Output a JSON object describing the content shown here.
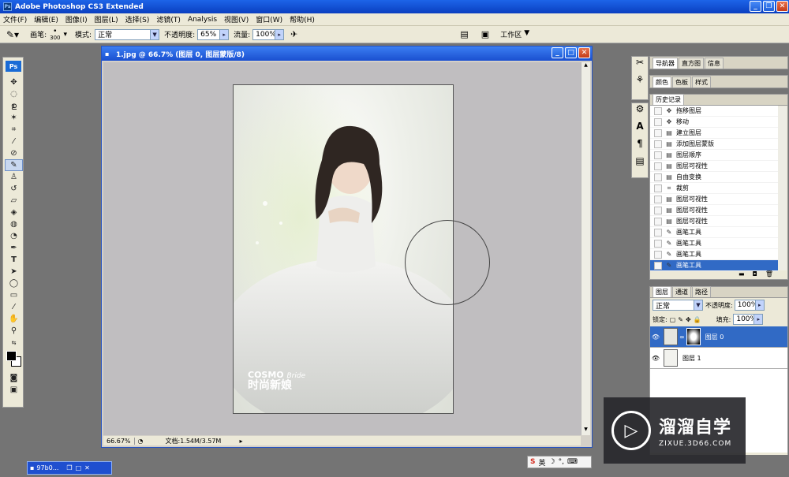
{
  "app": {
    "title": "Adobe Photoshop CS3 Extended",
    "logo": "Ps"
  },
  "menu": [
    "文件(F)",
    "编辑(E)",
    "图像(I)",
    "图层(L)",
    "选择(S)",
    "滤镜(T)",
    "Analysis",
    "视图(V)",
    "窗口(W)",
    "帮助(H)"
  ],
  "options": {
    "brush_label": "画笔:",
    "brush_size": "300",
    "mode_label": "模式:",
    "mode_value": "正常",
    "opacity_label": "不透明度:",
    "opacity_value": "65%",
    "flow_label": "流量:",
    "flow_value": "100%",
    "workspace_label": "工作区"
  },
  "document": {
    "title": "1.jpg @ 66.7% (图层 0, 图层蒙版/8)",
    "zoom": "66.67%",
    "doc_size": "文档:1.54M/3.57M",
    "photo_text_1": "COSMO",
    "photo_text_2": "Bride",
    "photo_text_3": "时尚新娘"
  },
  "navigator_tabs": [
    "导航器",
    "直方图",
    "信息"
  ],
  "color_tabs": [
    "颜色",
    "色板",
    "样式"
  ],
  "history": {
    "tab": "历史记录",
    "items": [
      {
        "label": "拖移图层",
        "icon": "move-icon"
      },
      {
        "label": "移动",
        "icon": "move-icon"
      },
      {
        "label": "建立图层",
        "icon": "layer-icon"
      },
      {
        "label": "添加图层蒙版",
        "icon": "layer-icon"
      },
      {
        "label": "图层顺序",
        "icon": "layer-icon"
      },
      {
        "label": "图层可视性",
        "icon": "layer-icon"
      },
      {
        "label": "自由变换",
        "icon": "layer-icon"
      },
      {
        "label": "裁剪",
        "icon": "crop-icon"
      },
      {
        "label": "图层可视性",
        "icon": "layer-icon"
      },
      {
        "label": "图层可视性",
        "icon": "layer-icon"
      },
      {
        "label": "图层可视性",
        "icon": "layer-icon"
      },
      {
        "label": "画笔工具",
        "icon": "brush-icon"
      },
      {
        "label": "画笔工具",
        "icon": "brush-icon"
      },
      {
        "label": "画笔工具",
        "icon": "brush-icon"
      },
      {
        "label": "画笔工具",
        "icon": "brush-icon",
        "selected": true
      }
    ]
  },
  "layers": {
    "tabs": [
      "图层",
      "通道",
      "路径"
    ],
    "blend_mode": "正常",
    "opacity_label": "不透明度:",
    "opacity_value": "100%",
    "lock_label": "锁定:",
    "fill_label": "填充:",
    "fill_value": "100%",
    "items": [
      {
        "name": "图层 0",
        "selected": true
      },
      {
        "name": "图层 1"
      }
    ]
  },
  "taskbar": {
    "minimized_doc": "97b0..."
  },
  "ime": {
    "mode": "英"
  },
  "watermark": {
    "title": "溜溜自学",
    "url": "ZIXUE.3D66.COM"
  },
  "colors": {
    "accent": "#316ac5",
    "titlebar": "#1d64e8"
  }
}
